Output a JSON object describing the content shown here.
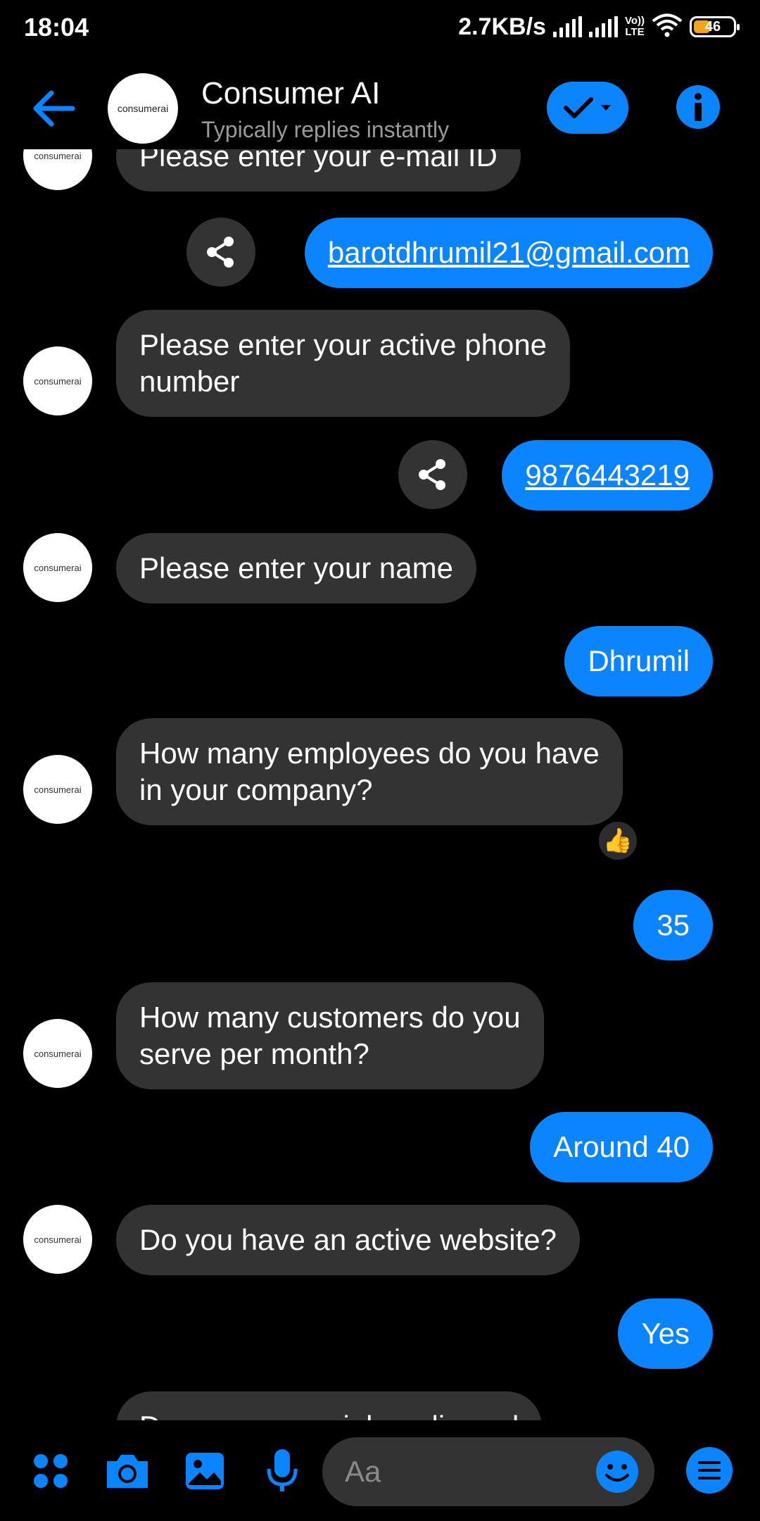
{
  "status_bar": {
    "time": "18:04",
    "net_speed": "2.7KB/s",
    "volte_top": "Vo))",
    "volte_bottom": "LTE",
    "battery": "46"
  },
  "header": {
    "name": "Consumer AI",
    "status": "Typically replies instantly",
    "avatar_text": "consumerai"
  },
  "messages": {
    "m0": "Please enter your e-mail ID",
    "m1": "barotdhrumil21@gmail.com",
    "m2_line1": "Please enter your active phone",
    "m2_line2": "number",
    "m3": "9876443219",
    "m4": "Please enter your name",
    "m5": "Dhrumil",
    "m6_line1": "How many employees do you have",
    "m6_line2": "in your company?",
    "m7": "35",
    "m8_line1": "How many customers do you",
    "m8_line2": "serve per month?",
    "m9": "Around 40",
    "m10": "Do you have an active website?",
    "m11": "Yes",
    "m12": "Do you use social media and"
  },
  "bot_avatar_text": "consumerai",
  "reaction": "👍",
  "composer": {
    "placeholder": "Aa"
  },
  "colors": {
    "accent": "#0a84ff",
    "incoming_bubble": "#333334",
    "background": "#000000"
  }
}
